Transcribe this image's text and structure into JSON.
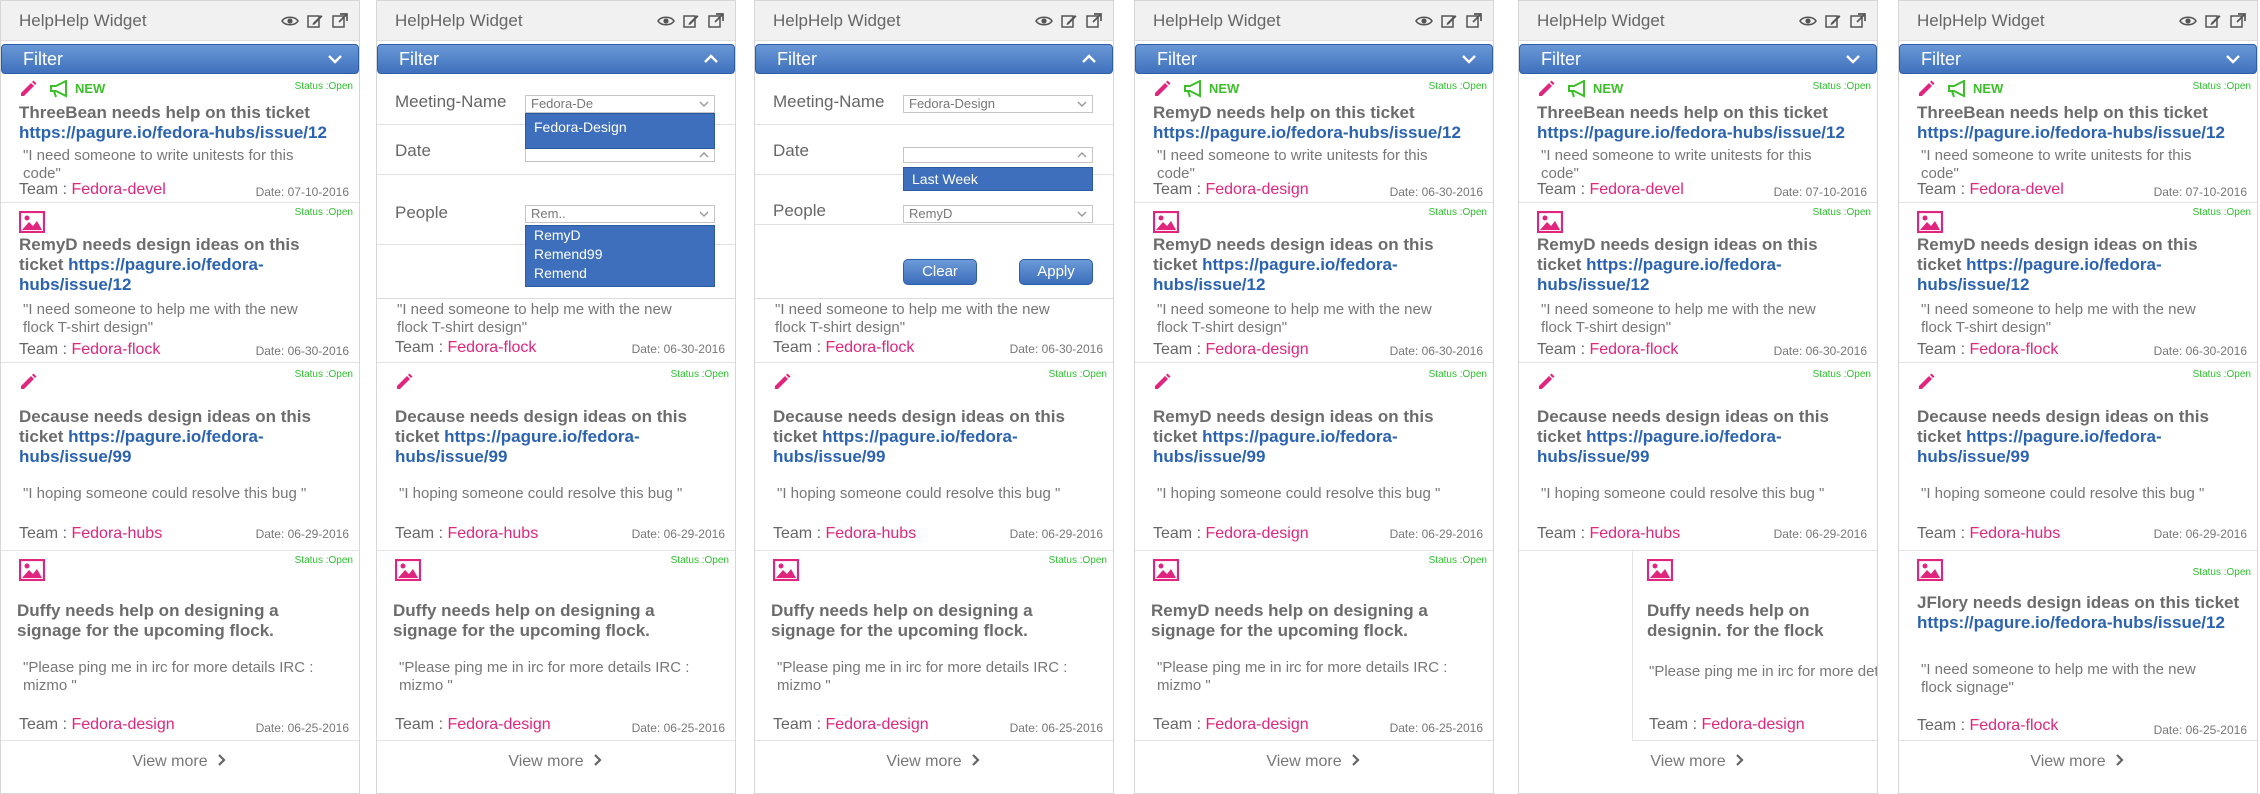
{
  "colors": {
    "accent": "#3f71bd",
    "team": "#e0257e",
    "link": "#2b63b0",
    "status": "#2fbf2f",
    "new": "#3cbf2a"
  },
  "widget": {
    "title": "HelpHelp Widget",
    "filter_label": "Filter",
    "view_more": "View more",
    "icons": [
      "eye-icon",
      "edit-icon",
      "external-link-icon"
    ]
  },
  "labels": {
    "status": "Status :Open",
    "team": "Team : ",
    "new": "NEW"
  },
  "cards": {
    "threebean": {
      "title": "ThreeBean needs help on this ticket ",
      "link": "https://pagure.io/fedora-hubs/issue/12",
      "quote": "\"I need someone  to write unitests for this code\"",
      "team": "Fedora-devel",
      "date": "Date: 07-10-2016"
    },
    "remyd_flock": {
      "title": "RemyD needs design ideas on this ticket ",
      "link": "https://pagure.io/fedora-hubs/issue/12",
      "quote": "\"I need someone to help me with the new flock T-shirt design\"",
      "team": "Fedora-flock",
      "date": "Date: 06-30-2016"
    },
    "remyd_design": {
      "title": "RemyD needs design ideas on this ticket ",
      "link": "https://pagure.io/fedora-hubs/issue/12",
      "quote": "\"I need someone to help me with the new flock T-shirt design\"",
      "team": "Fedora-design",
      "date": "Date: 06-30-2016"
    },
    "remyd_write": {
      "title": "RemyD needs help on this ticket ",
      "link": "https://pagure.io/fedora-hubs/issue/12",
      "quote": "\"I need someone  to write unitests for this code\"",
      "team": "Fedora-design",
      "date": "Date: 06-30-2016"
    },
    "decause_hubs": {
      "title": "Decause needs design ideas on this ticket ",
      "link": "https://pagure.io/fedora-hubs/issue/99",
      "quote": "\"I hoping someone could resolve this bug \"",
      "team": "Fedora-hubs",
      "date": "Date: 06-29-2016"
    },
    "remyd_bug": {
      "title": "RemyD needs design ideas on this ticket ",
      "link": "https://pagure.io/fedora-hubs/issue/99",
      "quote": "\"I hoping someone could resolve this bug \"",
      "team": "Fedora-design",
      "date": "Date: 06-29-2016"
    },
    "duffy": {
      "title": "Duffy needs help on designing a signage for the upcoming flock.",
      "quote": "\"Please ping me in irc for more details IRC : mizmo \"",
      "team": "Fedora-design",
      "date": "Date: 06-25-2016"
    },
    "remyd_signage": {
      "title": "RemyD needs help on designing a signage for the upcoming flock.",
      "quote": "\"Please ping me in irc for more details IRC : mizmo \"",
      "team": "Fedora-design",
      "date": "Date: 06-25-2016"
    },
    "duffy_short": {
      "title": "Duffy needs help on designin. for the flock",
      "quote": "\"Please ping me in irc for more det",
      "team": "Fedora-design"
    },
    "jflory": {
      "title": "JFlory needs design ideas on this ticket ",
      "link": "https://pagure.io/fedora-hubs/issue/12",
      "quote": "\"I need someone to help me with the new flock signage\"",
      "team": "Fedora-flock",
      "date": "Date: 06-25-2016"
    },
    "flock_tail": {
      "quote": "\"I need someone to help me with the new flock T-shirt design\"",
      "team": "Fedora-flock",
      "date": "Date: 06-30-2016"
    }
  },
  "filter_form": {
    "meeting_label": "Meeting-Name",
    "date_label": "Date",
    "people_label": "People",
    "panel2": {
      "meeting_value": "Fedora-De",
      "meeting_options": [
        "Fedora-Design"
      ],
      "people_value": "Rem..",
      "people_options": [
        "RemyD",
        "Remend99",
        "Remend"
      ]
    },
    "panel3": {
      "meeting_value": "Fedora-Design",
      "date_options": [
        "Last Week"
      ],
      "people_value": "RemyD",
      "clear": "Clear",
      "apply": "Apply"
    }
  }
}
